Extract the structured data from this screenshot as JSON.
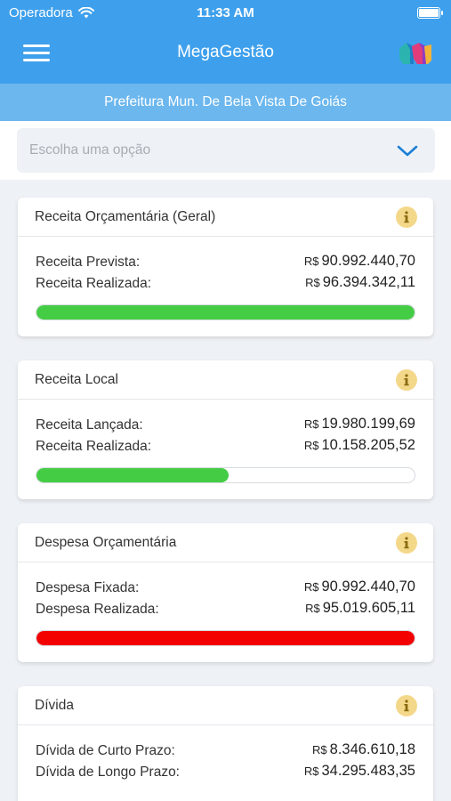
{
  "status": {
    "carrier": "Operadora",
    "time": "11:33 AM"
  },
  "nav": {
    "title": "MegaGestão"
  },
  "subheader": "Prefeitura Mun. De Bela Vista De Goiás",
  "selector": {
    "placeholder": "Escolha uma opção"
  },
  "currency": "R$",
  "colors": {
    "green": "#45cc45",
    "red": "#f30000",
    "primary": "#3ea0ec"
  },
  "cards": [
    {
      "title": "Receita Orçamentária (Geral)",
      "rows": [
        {
          "label": "Receita Prevista:",
          "value": "90.992.440,70"
        },
        {
          "label": "Receita Realizada:",
          "value": "96.394.342,11"
        }
      ],
      "progress": 1.0,
      "bar_color": "#45cc45"
    },
    {
      "title": "Receita Local",
      "rows": [
        {
          "label": "Receita Lançada:",
          "value": "19.980.199,69"
        },
        {
          "label": "Receita Realizada:",
          "value": "10.158.205,52"
        }
      ],
      "progress": 0.508,
      "bar_color": "#45cc45"
    },
    {
      "title": "Despesa Orçamentária",
      "rows": [
        {
          "label": "Despesa Fixada:",
          "value": "90.992.440,70"
        },
        {
          "label": "Despesa Realizada:",
          "value": "95.019.605,11"
        }
      ],
      "progress": 1.0,
      "bar_color": "#f30000"
    },
    {
      "title": "Dívida",
      "rows": [
        {
          "label": "Dívida de Curto Prazo:",
          "value": "8.346.610,18"
        },
        {
          "label": "Dívida de Longo Prazo:",
          "value": "34.295.483,35"
        }
      ]
    }
  ]
}
